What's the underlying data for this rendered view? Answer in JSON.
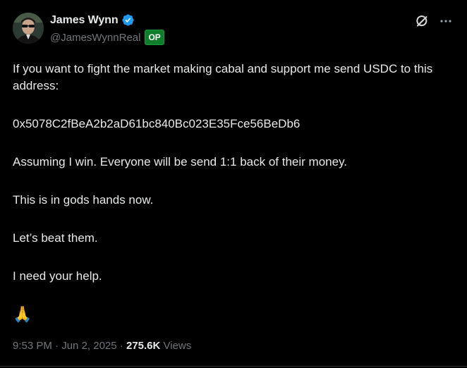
{
  "author": {
    "display_name": "James Wynn",
    "handle": "@JamesWynnReal",
    "badge": "OP",
    "verified": true
  },
  "colors": {
    "background": "#000000",
    "text": "#e7e9ea",
    "muted": "#71767b",
    "verified": "#1d9bf0",
    "op_badge": "#0f7d2a"
  },
  "icons": {
    "grok": "grok-icon",
    "more": "more-icon",
    "verified": "verified-badge-icon"
  },
  "post": {
    "paragraphs": [
      "If you want to fight the market making cabal and support me send USDC to this address:",
      "0x5078C2fBeA2b2aD61bc840Bc023E35Fce56BeDb6",
      "Assuming I win. Everyone will be send 1:1 back of their money.",
      "This is in gods hands now.",
      "Let’s beat them.",
      "I need your help."
    ],
    "emoji": "🙏"
  },
  "meta": {
    "time": "9:53 PM",
    "separator1": " · ",
    "date": "Jun 2, 2025",
    "separator2": " · ",
    "views_count": "275.6K",
    "views_label": " Views"
  }
}
